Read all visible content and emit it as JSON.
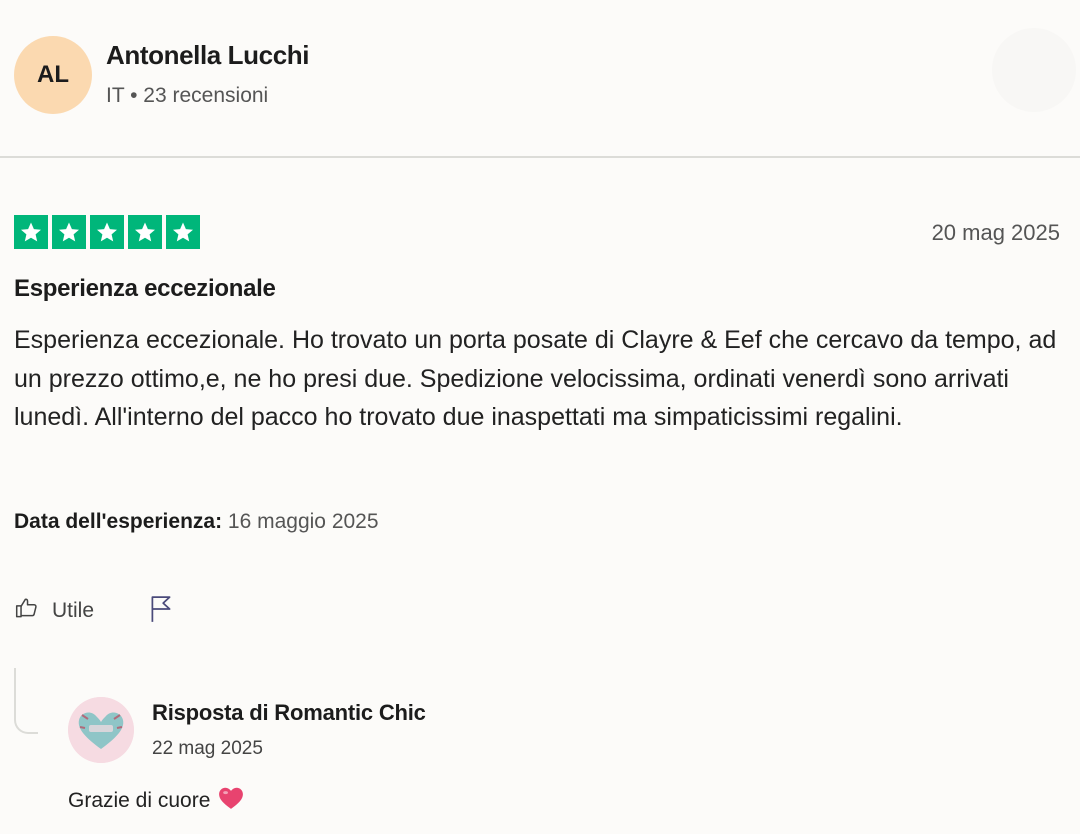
{
  "reviewer": {
    "initials": "AL",
    "name": "Antonella Lucchi",
    "meta": "IT • 23 recensioni"
  },
  "review": {
    "rating": 5,
    "date": "20 mag 2025",
    "title": "Esperienza eccezionale",
    "body": "Esperienza eccezionale. Ho trovato un porta posate di Clayre & Eef che cercavo da tempo, ad un prezzo ottimo,e, ne ho presi due. Spedizione velocissima, ordinati venerdì sono arrivati lunedì. All'interno del pacco ho trovato due inaspettati ma simpaticissimi regalini.",
    "experience_label": "Data dell'esperienza:",
    "experience_date": "16 maggio 2025"
  },
  "actions": {
    "useful_label": "Utile",
    "useful_icon": "thumbs-up-icon",
    "report_icon": "flag-icon"
  },
  "reply": {
    "title": "Risposta di Romantic Chic",
    "date": "22 mag 2025",
    "text": "Grazie di cuore",
    "emoji_icon": "heart-icon"
  },
  "colors": {
    "star_green": "#00b67a",
    "avatar_bg": "#fbd9b0",
    "heart": "#e8436f"
  }
}
